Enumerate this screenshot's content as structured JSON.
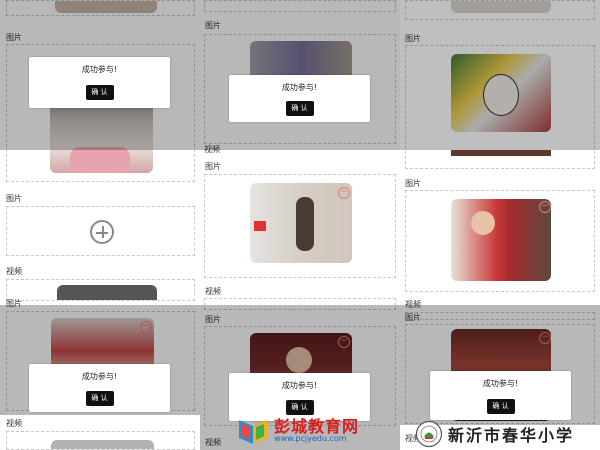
{
  "labels": {
    "image": "图片",
    "video": "视频"
  },
  "modal": {
    "message": "成功参与!",
    "confirm": "确 认"
  },
  "watermark": {
    "site_name": "彭城教育网",
    "site_url": "www.pcjyedu.com",
    "school_name": "新沂市春华小学"
  },
  "icons": {
    "add": "plus-circle-icon",
    "delete": "minus-circle-icon",
    "site_logo": "book-logo-icon",
    "school_logo": "school-seal-icon"
  },
  "colors": {
    "dialog_button": "#111111",
    "delete_icon": "#e87a7a",
    "site_name": "#d62020",
    "site_url": "#1d63c9"
  }
}
